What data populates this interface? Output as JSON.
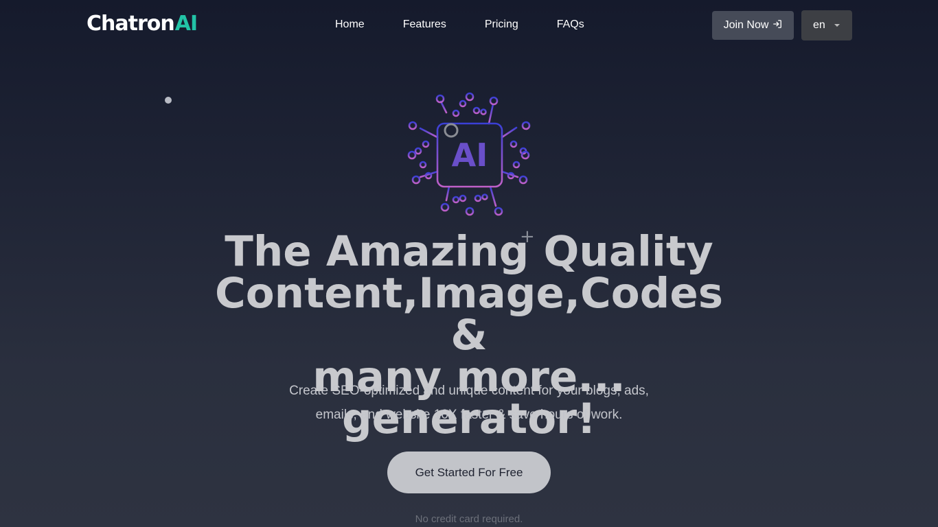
{
  "brand": {
    "name_main": "Chatron",
    "name_accent": "AI",
    "accent_color": "#22c3a6"
  },
  "nav": {
    "links": [
      {
        "label": "Home"
      },
      {
        "label": "Features"
      },
      {
        "label": "Pricing"
      },
      {
        "label": "FAQs"
      }
    ],
    "join_label": "Join Now",
    "join_icon": "sign-in-icon",
    "language": "en"
  },
  "hero": {
    "chip_text": "AI",
    "title_line1": "The Amazing Quality",
    "title_line2": "Content,Image,Codes &",
    "title_line3": "many more... generator!",
    "subtitle_line1": "Create SEO-optimized and unique content for your blogs, ads,",
    "subtitle_line2": "emails, and website 10X faster & save hours of work.",
    "cta_label": "Get Started For Free",
    "note": "No credit card required."
  },
  "colors": {
    "chip_top": "#3a3fd6",
    "chip_bottom": "#c060c8",
    "chip_text": "#6a4fc9"
  }
}
